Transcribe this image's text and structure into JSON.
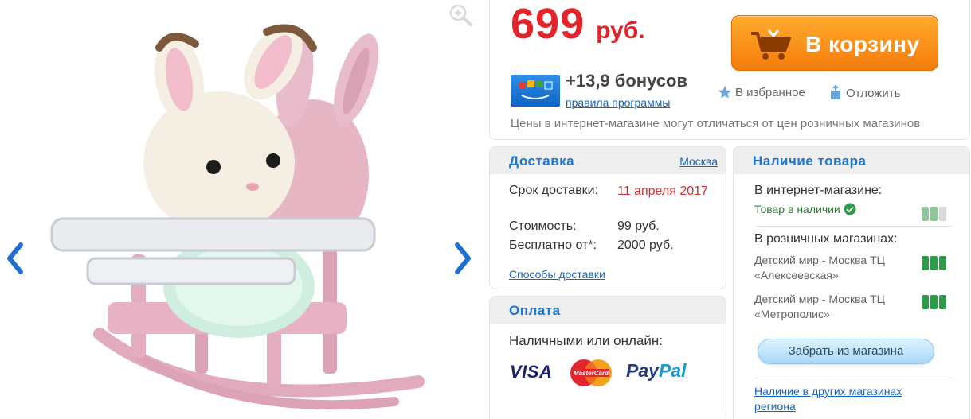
{
  "gallery": {
    "zoom_icon": "zoom-in-icon",
    "prev_icon": "chevron-left-icon",
    "next_icon": "chevron-right-icon"
  },
  "price": {
    "amount": "699",
    "currency": "руб."
  },
  "cart_button": {
    "label": "В корзину",
    "icon": "cart-icon"
  },
  "bonus": {
    "amount": "+13,9 бонусов",
    "rules_link": "правила программы"
  },
  "actions": {
    "favorite": "В избранное",
    "later": "Отложить"
  },
  "price_note": "Цены в интернет-магазине могут отличаться от цен розничных магазинов",
  "delivery": {
    "title": "Доставка",
    "city": "Москва",
    "rows": [
      {
        "label": "Срок доставки:",
        "value": "11 апреля 2017"
      },
      {
        "label": "Стоимость:",
        "value": "99 руб."
      },
      {
        "label": "Бесплатно от*:",
        "value": "2000 руб."
      }
    ],
    "methods_link": "Способы доставки"
  },
  "payment": {
    "title": "Оплата",
    "subtitle": "Наличными или онлайн:",
    "visa": "VISA",
    "mastercard": "MasterCard",
    "paypal_1": "Pay",
    "paypal_2": "Pal"
  },
  "availability": {
    "title": "Наличие товара",
    "online_label": "В интернет-магазине:",
    "online_status": "Товар в наличии",
    "retail_label": "В розничных магазинах:",
    "stores": [
      {
        "name": "Детский мир - Москва ТЦ «Алексеевская»"
      },
      {
        "name": "Детский мир - Москва ТЦ «Метрополис»"
      }
    ],
    "pickup_button": "Забрать из магазина",
    "other_stores_link": "Наличие в других магазинах региона"
  },
  "colors": {
    "price_red": "#e4242b",
    "cart_orange": "#f57c0a",
    "link_blue": "#1565c0",
    "stock_green": "#2e9b4a"
  }
}
